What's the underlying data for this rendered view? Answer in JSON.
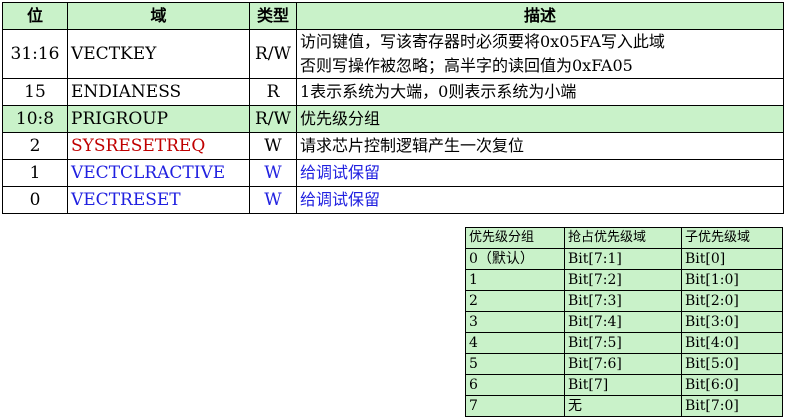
{
  "main_table": {
    "headers": [
      "位",
      "域",
      "类型",
      "描述"
    ],
    "rows": [
      {
        "bit": "31:16",
        "field": "VECTKEY",
        "type": "R/W",
        "desc": [
          "访问键值，写该寄存器时必须要将0x05FA写入此域",
          "否则写操作被忽略；高半字的读回值为0xFA05"
        ]
      },
      {
        "bit": "15",
        "field": "ENDIANESS",
        "type": "R",
        "desc": [
          "1表示系统为大端，0则表示系统为小端"
        ]
      },
      {
        "bit": "10:8",
        "field": "PRIGROUP",
        "type": "R/W",
        "desc": [
          "优先级分组"
        ]
      },
      {
        "bit": "2",
        "field": "SYSRESETREQ",
        "type": "W",
        "desc": [
          "请求芯片控制逻辑产生一次复位"
        ]
      },
      {
        "bit": "1",
        "field": "VECTCLRACTIVE",
        "type": "W",
        "desc": [
          "给调试保留"
        ]
      },
      {
        "bit": "0",
        "field": "VECTRESET",
        "type": "W",
        "desc": [
          "给调试保留"
        ]
      }
    ]
  },
  "priority_table": {
    "headers": [
      "优先级分组",
      "抢占优先级域",
      "子优先级域"
    ],
    "rows": [
      [
        "0（默认）",
        "Bit[7:1]",
        "Bit[0]"
      ],
      [
        "1",
        "Bit[7:2]",
        "Bit[1:0]"
      ],
      [
        "2",
        "Bit[7:3]",
        "Bit[2:0]"
      ],
      [
        "3",
        "Bit[7:4]",
        "Bit[3:0]"
      ],
      [
        "4",
        "Bit[7:5]",
        "Bit[4:0]"
      ],
      [
        "5",
        "Bit[7:6]",
        "Bit[5:0]"
      ],
      [
        "6",
        "Bit[7]",
        "Bit[6:0]"
      ],
      [
        "7",
        "无",
        "Bit[7:0]"
      ]
    ]
  },
  "colors": {
    "header_bg": "#c9f2c9",
    "highlight_row_bg": "#c9f2c9",
    "red_text": "#c00000",
    "blue_text": "#2020e0"
  }
}
